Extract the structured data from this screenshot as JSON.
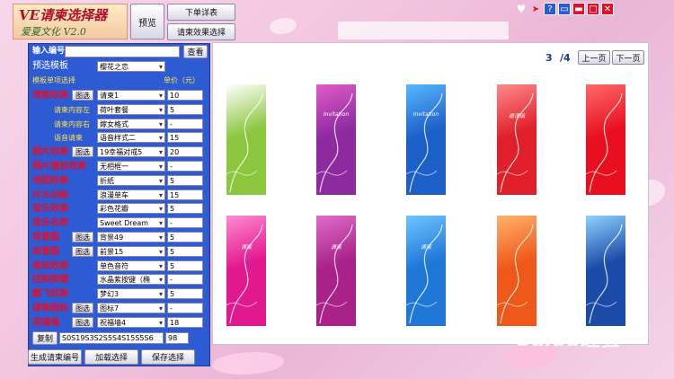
{
  "app": {
    "logo_title": "VE请柬选择器",
    "logo_sub": "爱夏文化 V2.0"
  },
  "toolbar": {
    "preview": "预览",
    "order_detail": "下单详表",
    "effect_select": "请柬效果选择"
  },
  "panel": {
    "input_label": "输入编号",
    "view_button": "查看",
    "preset_label": "预选模板",
    "preset_value": "樱花之恋",
    "template_header": "模板单项选择",
    "unit_price_header": "单价（元）",
    "pick_label": "图选",
    "copy_button": "复制",
    "code_value": "S0S19S3S2S5S4S15S5S6",
    "code_total": "98",
    "rows": [
      {
        "label": "请柬效果",
        "style": "red",
        "pick": true,
        "value": "请柬1",
        "price": "10"
      },
      {
        "label": "请柬内容左",
        "style": "yel",
        "pick": false,
        "value": "荷叶套餐",
        "price": "5"
      },
      {
        "label": "请柬内容右",
        "style": "yel",
        "pick": false,
        "value": "嫁女格式",
        "price": "-"
      },
      {
        "label": "语音请柬",
        "style": "yel",
        "pick": false,
        "value": "语音样式二",
        "price": "15"
      },
      {
        "label": "照片效果",
        "style": "red",
        "pick": true,
        "value": "19幸福对戒5",
        "price": "20"
      },
      {
        "label": "照片播放效果",
        "style": "red",
        "pick": false,
        "value": "无相框一",
        "price": "-"
      },
      {
        "label": "地图效果",
        "style": "red",
        "pick": false,
        "value": "折纸",
        "price": "5"
      },
      {
        "label": "片头动画",
        "style": "red",
        "pick": false,
        "value": "浪漫单车",
        "price": "15"
      },
      {
        "label": "音乐效果",
        "style": "red",
        "pick": false,
        "value": "彩色花瓣",
        "price": "5"
      },
      {
        "label": "音乐名称",
        "style": "red",
        "pick": false,
        "value": "Sweet Dream",
        "price": "-"
      },
      {
        "label": "背景图",
        "style": "red",
        "pick": true,
        "value": "背景49",
        "price": "5"
      },
      {
        "label": "前景图",
        "style": "red",
        "pick": true,
        "value": "前景15",
        "price": "5"
      },
      {
        "label": "鼠标效果",
        "style": "red",
        "pick": false,
        "value": "单色音符",
        "price": "5"
      },
      {
        "label": "控制按键",
        "style": "red",
        "pick": false,
        "value": "水晶紫按键（椭",
        "price": "-"
      },
      {
        "label": "飘飞效果",
        "style": "red",
        "pick": false,
        "value": "梦幻3",
        "price": "5"
      },
      {
        "label": "请柬图标",
        "style": "red",
        "pick": true,
        "value": "图标7",
        "price": "-"
      },
      {
        "label": "祝福墙",
        "style": "red",
        "pick": true,
        "value": "祝福墙4",
        "price": "18"
      }
    ],
    "generate_button": "生成请柬编号",
    "load_button": "加载选择",
    "save_button": "保存选择"
  },
  "pager": {
    "current": "3",
    "total": "/4",
    "prev": "上一页",
    "next": "下一页"
  },
  "gallery": {
    "cards": [
      {
        "bg": "#8cc63f",
        "accent": "#ffffff",
        "text": ""
      },
      {
        "bg": "#8e2aa0",
        "accent": "#e05cc8",
        "text": "Invitation"
      },
      {
        "bg": "#1d5fc9",
        "accent": "#58b7ff",
        "text": "Invitation"
      },
      {
        "bg": "#e01f2b",
        "accent": "#ff8a8a",
        "text": "邀请函"
      },
      {
        "bg": "#e81020",
        "accent": "#ff6a6a",
        "text": ""
      },
      {
        "bg": "#e2188f",
        "accent": "#ff8ad0",
        "text": "请柬"
      },
      {
        "bg": "#a8228a",
        "accent": "#e06cc8",
        "text": "请柬"
      },
      {
        "bg": "#1f77d8",
        "accent": "#6fc5ff",
        "text": "请柬"
      },
      {
        "bg": "#f0581a",
        "accent": "#ffb36a",
        "text": ""
      },
      {
        "bg": "#1c4aa8",
        "accent": "#8fd3ff",
        "text": ""
      }
    ]
  },
  "watermark": "Baidu经验"
}
